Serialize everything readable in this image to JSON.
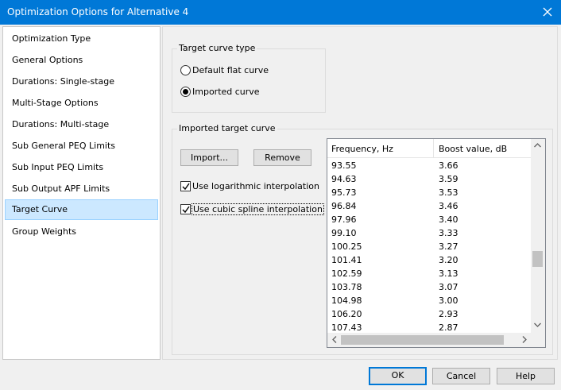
{
  "window": {
    "title": "Optimization Options for Alternative 4",
    "close_icon": "close-icon"
  },
  "sidebar": {
    "items": [
      {
        "label": "Optimization Type"
      },
      {
        "label": "General Options"
      },
      {
        "label": "Durations: Single-stage"
      },
      {
        "label": "Multi-Stage Options"
      },
      {
        "label": "Durations: Multi-stage"
      },
      {
        "label": "Sub General PEQ Limits"
      },
      {
        "label": "Sub Input PEQ Limits"
      },
      {
        "label": "Sub Output APF Limits"
      },
      {
        "label": "Target Curve",
        "selected": true
      },
      {
        "label": "Group Weights"
      }
    ]
  },
  "target_type": {
    "legend": "Target curve type",
    "options": [
      {
        "label": "Default flat curve",
        "checked": false
      },
      {
        "label": "Imported curve",
        "checked": true
      }
    ]
  },
  "imported": {
    "legend": "Imported target curve",
    "import_label": "Import...",
    "remove_label": "Remove",
    "log_interp_label": "Use logarithmic interpolation",
    "log_interp_checked": true,
    "spline_label": "Use cubic spline interpolation",
    "spline_checked": true,
    "columns": [
      "Frequency, Hz",
      "Boost value, dB"
    ],
    "rows": [
      [
        "93.55",
        "3.66"
      ],
      [
        "94.63",
        "3.59"
      ],
      [
        "95.73",
        "3.53"
      ],
      [
        "96.84",
        "3.46"
      ],
      [
        "97.96",
        "3.40"
      ],
      [
        "99.10",
        "3.33"
      ],
      [
        "100.25",
        "3.27"
      ],
      [
        "101.41",
        "3.20"
      ],
      [
        "102.59",
        "3.13"
      ],
      [
        "103.78",
        "3.07"
      ],
      [
        "104.98",
        "3.00"
      ],
      [
        "106.20",
        "2.93"
      ],
      [
        "107.43",
        "2.87"
      ]
    ]
  },
  "footer": {
    "ok_label": "OK",
    "cancel_label": "Cancel",
    "help_label": "Help"
  },
  "colors": {
    "titlebar": "#0078d7",
    "selection": "#cce8ff",
    "default_button_border": "#0078d7"
  }
}
